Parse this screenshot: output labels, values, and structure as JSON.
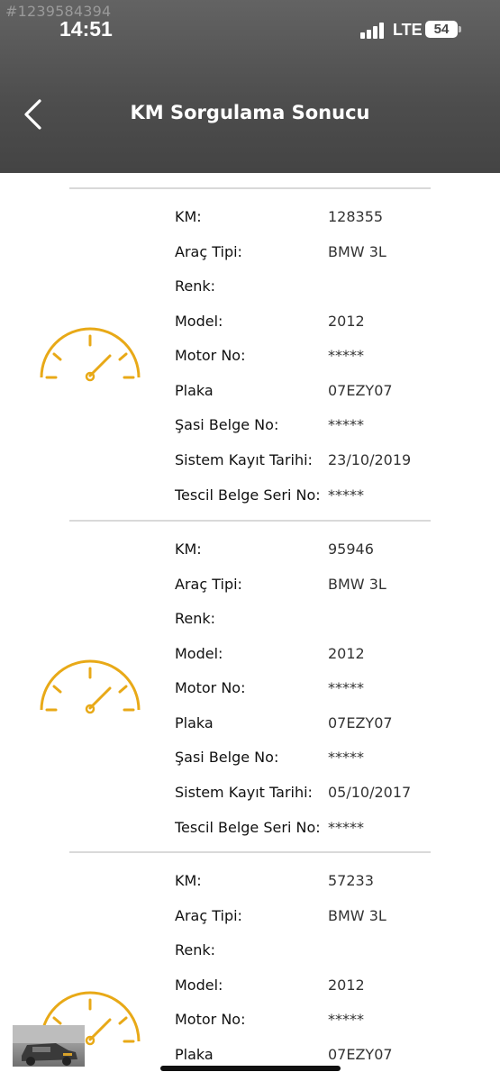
{
  "watermark": "#1239584394",
  "status_bar": {
    "time": "14:51",
    "network": "LTE",
    "battery": "54"
  },
  "header": {
    "title": "KM Sorgulama Sonucu",
    "back_icon": "chevron-left-icon"
  },
  "colors": {
    "header_bg": "#4d4d4d",
    "gauge": "#e8a917",
    "divider": "#d9d9d9"
  },
  "records": [
    {
      "gauge_icon": "speedometer-icon",
      "fields": [
        {
          "label": "KM:",
          "value": "128355"
        },
        {
          "label": "Araç Tipi:",
          "value": "BMW 3L"
        },
        {
          "label": "Renk:",
          "value": ""
        },
        {
          "label": "Model:",
          "value": "2012"
        },
        {
          "label": "Motor No:",
          "value": "*****"
        },
        {
          "label": "Plaka",
          "value": "07EZY07"
        },
        {
          "label": "Şasi Belge No:",
          "value": "*****"
        },
        {
          "label": "Sistem Kayıt Tarihi:",
          "value": "23/10/2019"
        },
        {
          "label": "Tescil Belge Seri No:",
          "value": "*****"
        }
      ]
    },
    {
      "gauge_icon": "speedometer-icon",
      "fields": [
        {
          "label": "KM:",
          "value": "95946"
        },
        {
          "label": "Araç Tipi:",
          "value": "BMW 3L"
        },
        {
          "label": "Renk:",
          "value": ""
        },
        {
          "label": "Model:",
          "value": "2012"
        },
        {
          "label": "Motor No:",
          "value": "*****"
        },
        {
          "label": "Plaka",
          "value": "07EZY07"
        },
        {
          "label": "Şasi Belge No:",
          "value": "*****"
        },
        {
          "label": "Sistem Kayıt Tarihi:",
          "value": "05/10/2017"
        },
        {
          "label": "Tescil Belge Seri No:",
          "value": "*****"
        }
      ]
    },
    {
      "gauge_icon": "speedometer-icon",
      "fields": [
        {
          "label": "KM:",
          "value": "57233"
        },
        {
          "label": "Araç Tipi:",
          "value": "BMW 3L"
        },
        {
          "label": "Renk:",
          "value": ""
        },
        {
          "label": "Model:",
          "value": "2012"
        },
        {
          "label": "Motor No:",
          "value": "*****"
        },
        {
          "label": "Plaka",
          "value": "07EZY07"
        }
      ]
    }
  ]
}
